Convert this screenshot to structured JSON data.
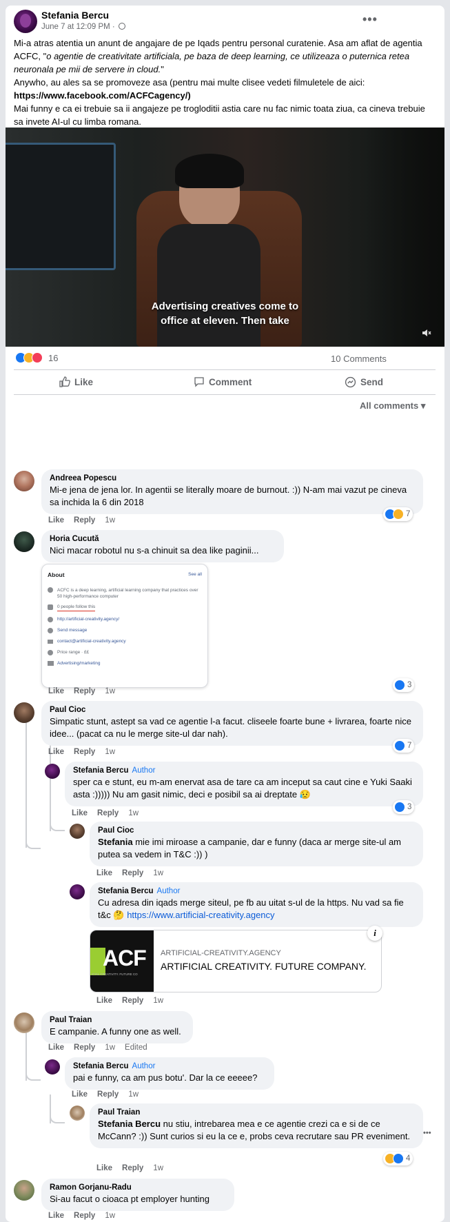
{
  "post": {
    "author": "Stefania Bercu",
    "date": "June 7 at 12:09 PM ·",
    "body_line1": "Mi-a atras atentia un anunt de angajare de pe Iqads pentru personal curatenie. Asa am aflat de agentia ACFC, \"",
    "body_italic": "o agentie de creativitate artificiala, pe baza de deep learning, ce utilizeaza o puternica retea neuronala pe mii de servere in cloud.",
    "body_line1_end": "\"",
    "body_line2": "Anywho, au ales sa se promoveze asa (pentru mai multe clisee vedeti filmuletele de aici:",
    "body_link": "https://www.facebook.com/ACFCagency/)",
    "body_line3": "Mai funny e ca ei trebuie sa ii angajeze pe trogloditii astia care nu fac nimic toata ziua, ca cineva trebuie sa invete AI-ul cu limba romana.",
    "video_caption_1": "Advertising creatives come to",
    "video_caption_2": "office at eleven. Then take",
    "reaction_count": "16",
    "comments_count": "10 Comments",
    "like_label": "Like",
    "comment_label": "Comment",
    "send_label": "Send",
    "sort_label": "All comments"
  },
  "actions": {
    "like": "Like",
    "reply": "Reply",
    "edited": "Edited"
  },
  "author_badge": "Author",
  "comments": [
    {
      "name": "Andreea Popescu",
      "text": "Mi-e jena de jena lor. In agentii se literally moare de burnout. :)) N-am mai vazut pe cineva sa inchida la 6 din 2018",
      "time": "1w",
      "reactions": "7"
    },
    {
      "name": "Horia Cucută",
      "text": "Nici macar robotul nu s-a chinuit sa dea like paginii...",
      "time": "1w",
      "reactions": "3"
    },
    {
      "name": "Paul Cioc",
      "text": "Simpatic stunt, astept sa vad ce agentie l-a facut. cliseele foarte bune + livrarea, foarte nice idee... (pacat ca nu le merge site-ul dar nah).",
      "time": "1w",
      "reactions": "7"
    },
    {
      "name": "Stefania Bercu",
      "text": "sper ca e stunt, eu m-am enervat asa de tare ca am inceput sa caut cine e Yuki Saaki asta :))))) Nu am gasit nimic, deci e posibil sa ai dreptate 😥",
      "time": "1w",
      "reactions": "3"
    },
    {
      "name": "Paul Cioc",
      "mention": "Stefania",
      "text": " mie imi miroase a campanie, dar e funny (daca ar merge site-ul am putea sa vedem in T&C :)) )",
      "time": "1w"
    },
    {
      "name": "Stefania Bercu",
      "text": "Cu adresa din iqads merge siteul, pe fb au uitat s-ul de la https. Nu vad sa fie t&c 🤔 ",
      "link": "https://www.artificial-creativity.agency",
      "time": "1w"
    },
    {
      "name": "Paul Traian",
      "text": "E campanie. A funny one as well.",
      "time": "1w"
    },
    {
      "name": "Stefania Bercu",
      "text": "pai e funny, ca am pus botu'. Dar la ce eeeee?",
      "time": "1w"
    },
    {
      "name": "Paul Traian",
      "mention": "Stefania Bercu",
      "text": " nu stiu, intrebarea mea e ce agentie crezi ca e si de ce McCann? :)) Sunt curios si eu la ce e, probs ceva recrutare sau PR eveniment.",
      "time": "1w",
      "reactions": "4"
    },
    {
      "name": "Ramon Gorjanu-Radu",
      "text": "Si-au facut o cioaca pt employer hunting",
      "time": "1w"
    }
  ],
  "about_screenshot": {
    "title": "About",
    "see_all": "See all",
    "desc": "ACFC is a deep learning, artificial learning company that practices over 50 high-performance computer",
    "followers": "0 people follow this",
    "url": "http://artificial-creativity.agency/",
    "message": "Send message",
    "email": "contact@artificial-creativity.agency",
    "price": "Price range · ££",
    "category": "Advertising/marketing"
  },
  "link_preview": {
    "logo_text": "ACF",
    "logo_sub": "ICIAL CREATIVITY. FUTURE CO",
    "domain": "ARTIFICIAL-CREATIVITY.AGENCY",
    "title": "ARTIFICIAL CREATIVITY. FUTURE COMPANY.",
    "info": "i"
  },
  "colors": {
    "accent": "#1877f2",
    "link": "#0a5bd8",
    "bubble": "#f0f2f5"
  }
}
